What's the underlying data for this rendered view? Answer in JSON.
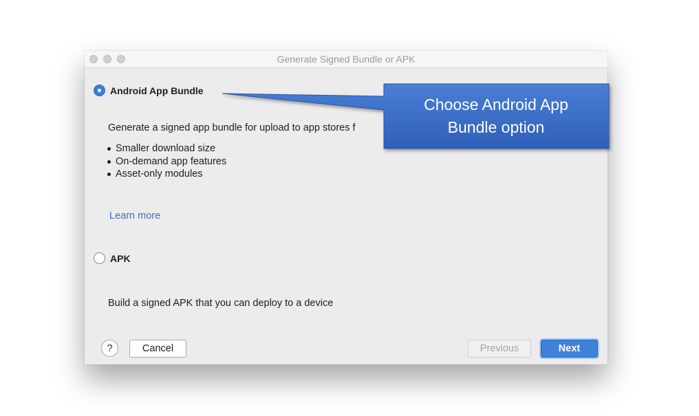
{
  "window": {
    "title": "Generate Signed Bundle or APK"
  },
  "options": {
    "bundle": {
      "label": "Android App Bundle",
      "selected": true,
      "description": "Generate a signed app bundle for upload to app stores f",
      "features": [
        "Smaller download size",
        "On-demand app features",
        "Asset-only modules"
      ],
      "link": "Learn more"
    },
    "apk": {
      "label": "APK",
      "selected": false,
      "description": "Build a signed APK that you can deploy to a device"
    }
  },
  "footer": {
    "help": "?",
    "cancel": "Cancel",
    "previous": "Previous",
    "next": "Next"
  },
  "callout": {
    "text": "Choose Android App\nBundle option"
  },
  "colors": {
    "accent": "#3f82d9",
    "callout": "#3a6cc8",
    "link": "#3f6fbf"
  }
}
